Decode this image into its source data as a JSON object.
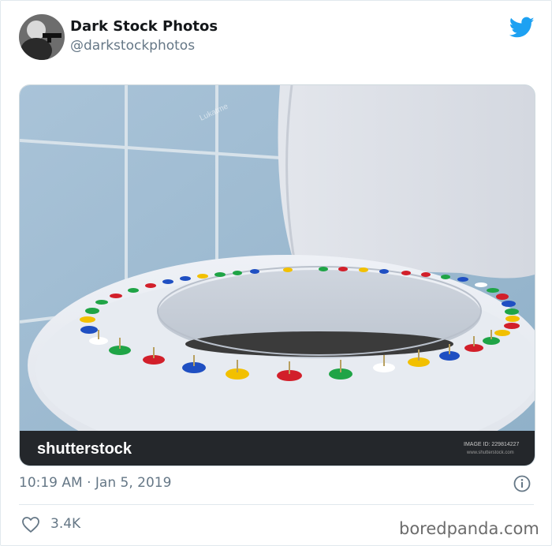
{
  "tweet": {
    "display_name": "Dark Stock Photos",
    "handle": "@darkstockphotos",
    "timestamp": "10:19 AM · Jan 5, 2019",
    "like_count": "3.4K"
  },
  "media": {
    "brand": "shutterstock",
    "image_id": "IMAGE ID: 229814227",
    "site": "www.shutterstock.com",
    "photographer_watermark": "Lukatme"
  },
  "icons": {
    "avatar": "avatar",
    "logo": "twitter-bird-icon",
    "info": "info-icon",
    "like": "heart-icon"
  },
  "source_watermark": "boredpanda.com",
  "colors": {
    "twitter_blue": "#1da1f2",
    "text_primary": "#14171a",
    "text_secondary": "#657786",
    "divider": "#e1e8ed"
  }
}
